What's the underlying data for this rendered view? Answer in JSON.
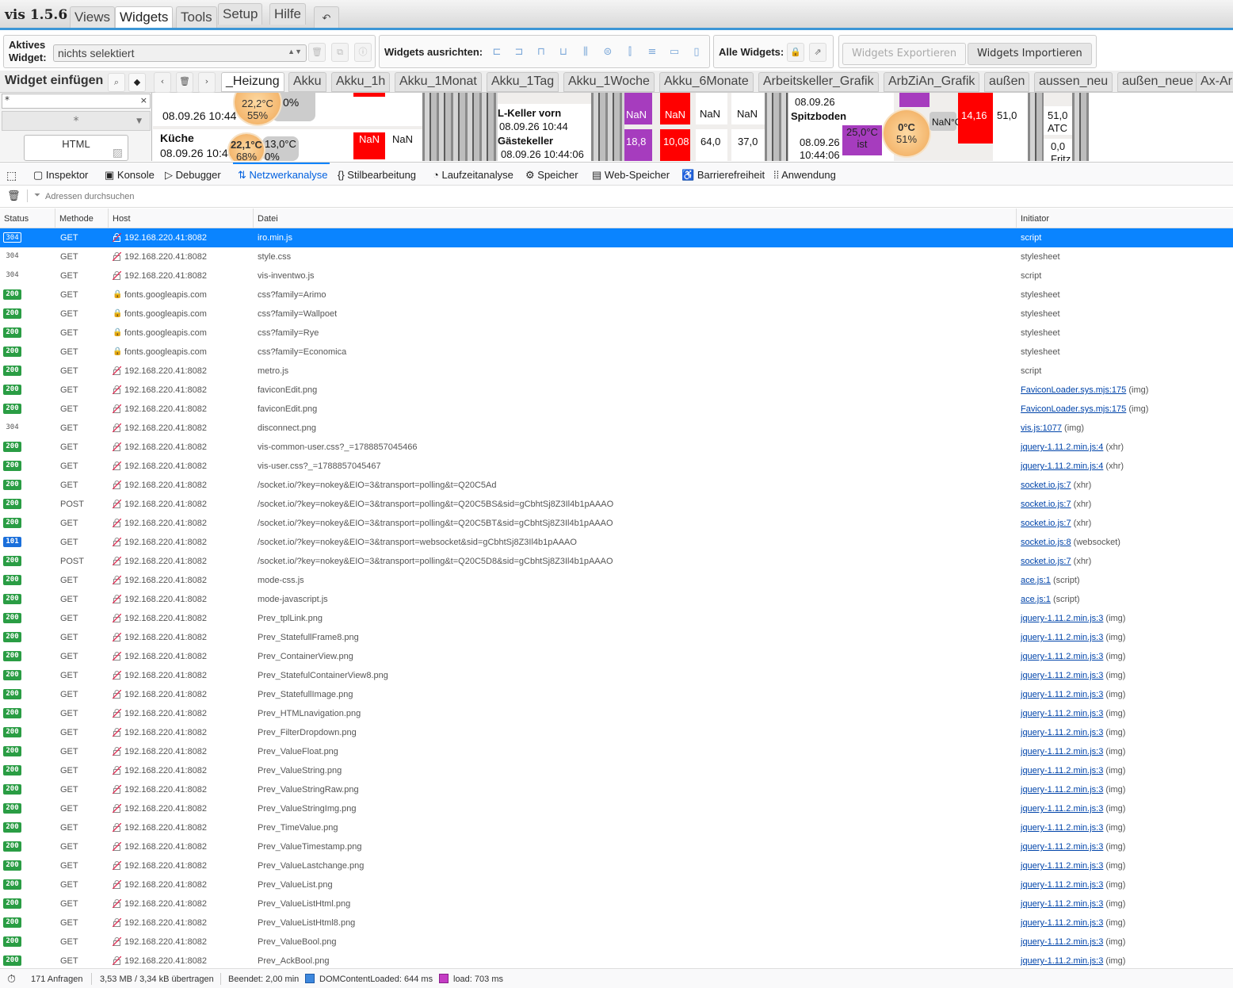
{
  "app": {
    "title": "vis 1.5.6",
    "menu_tabs": [
      "Views",
      "Widgets",
      "Tools",
      "Setup",
      "Hilfe"
    ],
    "undo_icon": "undo-icon"
  },
  "toolbar": {
    "active_widget_label": "Aktives Widget:",
    "active_widget_label_l1": "Aktives",
    "active_widget_label_l2": "Widget:",
    "active_widget_value": "nichts selektiert",
    "align_label": "Widgets ausrichten:",
    "all_widgets_label": "Alle Widgets:",
    "export_label": "Widgets Exportieren",
    "import_label": "Widgets Importieren"
  },
  "insert_bar": {
    "title": "Widget einfügen",
    "views": [
      "_Heizung",
      "Akku",
      "Akku_1h",
      "Akku_1Monat",
      "Akku_1Tag",
      "Akku_1Woche",
      "Akku_6Monate",
      "Arbeitskeller_Grafik",
      "ArbZiAn_Grafik",
      "außen",
      "aussen_neu",
      "außen_neue",
      "Ax-Ar"
    ]
  },
  "side_panel": {
    "filter_value": "*",
    "category_value": "*",
    "widget_name": "HTML"
  },
  "canvas": {
    "t1": "08.09.26 10:44",
    "temp1": "22,2°C",
    "hum1": "55%",
    "pct1": "0%",
    "kueche": "Küche",
    "t2": "08.09.26 10:44",
    "temp2": "22,1°C",
    "hum2": "68%",
    "val2": "13,0°C",
    "pct2": "0%",
    "nan1": "NaN",
    "nan2": "NaN",
    "lkeller": "L-Keller vorn",
    "t3": "08.09.26 10:44",
    "gaeste": "Gästekeller",
    "t4": "08.09.26 10:44:06",
    "nan3": "NaN",
    "nan4": "NaN",
    "nan5": "NaN",
    "nan6": "NaN",
    "v1": "18,8",
    "v2": "10,08",
    "v3": "64,0",
    "v4": "37,0",
    "t5": "08.09.26",
    "spitz": "Spitzboden",
    "t6": "08.09.26",
    "t7": "10:44:06",
    "ist": "25,0°C",
    "ist_lbl": "ist",
    "temp3": "0°C",
    "hum3": "51%",
    "nan7": "NaN°C",
    "v5": "14,16",
    "v6": "51,0",
    "v7": "51,0",
    "atc": "ATC",
    "v8": "0,0",
    "fritz": "Fritz"
  },
  "devtools": {
    "tabs": [
      "Inspektor",
      "Konsole",
      "Debugger",
      "Netzwerkanalyse",
      "Stilbearbeitung",
      "Laufzeitanalyse",
      "Speicher",
      "Web-Speicher",
      "Barrierefreiheit",
      "Anwendung"
    ],
    "filter_placeholder": "Adressen durchsuchen",
    "columns": [
      "Status",
      "Methode",
      "Host",
      "Datei",
      "Initiator"
    ]
  },
  "requests": [
    {
      "status": "304",
      "method": "GET",
      "host": "192.168.220.41:8082",
      "file": "iro.min.js",
      "initiator": "script",
      "link": "",
      "selected": true
    },
    {
      "status": "304",
      "method": "GET",
      "host": "192.168.220.41:8082",
      "file": "style.css",
      "initiator": "stylesheet",
      "link": ""
    },
    {
      "status": "304",
      "method": "GET",
      "host": "192.168.220.41:8082",
      "file": "vis-inventwo.js",
      "initiator": "script",
      "link": ""
    },
    {
      "status": "200",
      "method": "GET",
      "host": "fonts.googleapis.com",
      "file": "css?family=Arimo",
      "initiator": "stylesheet",
      "link": "",
      "lock": true
    },
    {
      "status": "200",
      "method": "GET",
      "host": "fonts.googleapis.com",
      "file": "css?family=Wallpoet",
      "initiator": "stylesheet",
      "link": "",
      "lock": true
    },
    {
      "status": "200",
      "method": "GET",
      "host": "fonts.googleapis.com",
      "file": "css?family=Rye",
      "initiator": "stylesheet",
      "link": "",
      "lock": true
    },
    {
      "status": "200",
      "method": "GET",
      "host": "fonts.googleapis.com",
      "file": "css?family=Economica",
      "initiator": "stylesheet",
      "link": "",
      "lock": true
    },
    {
      "status": "200",
      "method": "GET",
      "host": "192.168.220.41:8082",
      "file": "metro.js",
      "initiator": "script",
      "link": ""
    },
    {
      "status": "200",
      "method": "GET",
      "host": "192.168.220.41:8082",
      "file": "faviconEdit.png",
      "initiator": " (img)",
      "link": "FaviconLoader.sys.mjs:175"
    },
    {
      "status": "200",
      "method": "GET",
      "host": "192.168.220.41:8082",
      "file": "faviconEdit.png",
      "initiator": " (img)",
      "link": "FaviconLoader.sys.mjs:175"
    },
    {
      "status": "304",
      "method": "GET",
      "host": "192.168.220.41:8082",
      "file": "disconnect.png",
      "initiator": " (img)",
      "link": "vis.js:1077"
    },
    {
      "status": "200",
      "method": "GET",
      "host": "192.168.220.41:8082",
      "file": "vis-common-user.css?_=1788857045466",
      "initiator": " (xhr)",
      "link": "jquery-1.11.2.min.js:4"
    },
    {
      "status": "200",
      "method": "GET",
      "host": "192.168.220.41:8082",
      "file": "vis-user.css?_=1788857045467",
      "initiator": " (xhr)",
      "link": "jquery-1.11.2.min.js:4"
    },
    {
      "status": "200",
      "method": "GET",
      "host": "192.168.220.41:8082",
      "file": "/socket.io/?key=nokey&EIO=3&transport=polling&t=Q20C5Ad",
      "initiator": " (xhr)",
      "link": "socket.io.js:7"
    },
    {
      "status": "200",
      "method": "POST",
      "host": "192.168.220.41:8082",
      "file": "/socket.io/?key=nokey&EIO=3&transport=polling&t=Q20C5BS&sid=gCbhtSj8Z3Il4b1pAAAO",
      "initiator": " (xhr)",
      "link": "socket.io.js:7"
    },
    {
      "status": "200",
      "method": "GET",
      "host": "192.168.220.41:8082",
      "file": "/socket.io/?key=nokey&EIO=3&transport=polling&t=Q20C5BT&sid=gCbhtSj8Z3Il4b1pAAAO",
      "initiator": " (xhr)",
      "link": "socket.io.js:7"
    },
    {
      "status": "101",
      "method": "GET",
      "host": "192.168.220.41:8082",
      "file": "/socket.io/?key=nokey&EIO=3&transport=websocket&sid=gCbhtSj8Z3Il4b1pAAAO",
      "initiator": " (websocket)",
      "link": "socket.io.js:8"
    },
    {
      "status": "200",
      "method": "POST",
      "host": "192.168.220.41:8082",
      "file": "/socket.io/?key=nokey&EIO=3&transport=polling&t=Q20C5D8&sid=gCbhtSj8Z3Il4b1pAAAO",
      "initiator": " (xhr)",
      "link": "socket.io.js:7"
    },
    {
      "status": "200",
      "method": "GET",
      "host": "192.168.220.41:8082",
      "file": "mode-css.js",
      "initiator": " (script)",
      "link": "ace.js:1"
    },
    {
      "status": "200",
      "method": "GET",
      "host": "192.168.220.41:8082",
      "file": "mode-javascript.js",
      "initiator": " (script)",
      "link": "ace.js:1"
    },
    {
      "status": "200",
      "method": "GET",
      "host": "192.168.220.41:8082",
      "file": "Prev_tplLink.png",
      "initiator": " (img)",
      "link": "jquery-1.11.2.min.js:3"
    },
    {
      "status": "200",
      "method": "GET",
      "host": "192.168.220.41:8082",
      "file": "Prev_StatefullFrame8.png",
      "initiator": " (img)",
      "link": "jquery-1.11.2.min.js:3"
    },
    {
      "status": "200",
      "method": "GET",
      "host": "192.168.220.41:8082",
      "file": "Prev_ContainerView.png",
      "initiator": " (img)",
      "link": "jquery-1.11.2.min.js:3"
    },
    {
      "status": "200",
      "method": "GET",
      "host": "192.168.220.41:8082",
      "file": "Prev_StatefulContainerView8.png",
      "initiator": " (img)",
      "link": "jquery-1.11.2.min.js:3"
    },
    {
      "status": "200",
      "method": "GET",
      "host": "192.168.220.41:8082",
      "file": "Prev_StatefullImage.png",
      "initiator": " (img)",
      "link": "jquery-1.11.2.min.js:3"
    },
    {
      "status": "200",
      "method": "GET",
      "host": "192.168.220.41:8082",
      "file": "Prev_HTMLnavigation.png",
      "initiator": " (img)",
      "link": "jquery-1.11.2.min.js:3"
    },
    {
      "status": "200",
      "method": "GET",
      "host": "192.168.220.41:8082",
      "file": "Prev_FilterDropdown.png",
      "initiator": " (img)",
      "link": "jquery-1.11.2.min.js:3"
    },
    {
      "status": "200",
      "method": "GET",
      "host": "192.168.220.41:8082",
      "file": "Prev_ValueFloat.png",
      "initiator": " (img)",
      "link": "jquery-1.11.2.min.js:3"
    },
    {
      "status": "200",
      "method": "GET",
      "host": "192.168.220.41:8082",
      "file": "Prev_ValueString.png",
      "initiator": " (img)",
      "link": "jquery-1.11.2.min.js:3"
    },
    {
      "status": "200",
      "method": "GET",
      "host": "192.168.220.41:8082",
      "file": "Prev_ValueStringRaw.png",
      "initiator": " (img)",
      "link": "jquery-1.11.2.min.js:3"
    },
    {
      "status": "200",
      "method": "GET",
      "host": "192.168.220.41:8082",
      "file": "Prev_ValueStringImg.png",
      "initiator": " (img)",
      "link": "jquery-1.11.2.min.js:3"
    },
    {
      "status": "200",
      "method": "GET",
      "host": "192.168.220.41:8082",
      "file": "Prev_TimeValue.png",
      "initiator": " (img)",
      "link": "jquery-1.11.2.min.js:3"
    },
    {
      "status": "200",
      "method": "GET",
      "host": "192.168.220.41:8082",
      "file": "Prev_ValueTimestamp.png",
      "initiator": " (img)",
      "link": "jquery-1.11.2.min.js:3"
    },
    {
      "status": "200",
      "method": "GET",
      "host": "192.168.220.41:8082",
      "file": "Prev_ValueLastchange.png",
      "initiator": " (img)",
      "link": "jquery-1.11.2.min.js:3"
    },
    {
      "status": "200",
      "method": "GET",
      "host": "192.168.220.41:8082",
      "file": "Prev_ValueList.png",
      "initiator": " (img)",
      "link": "jquery-1.11.2.min.js:3"
    },
    {
      "status": "200",
      "method": "GET",
      "host": "192.168.220.41:8082",
      "file": "Prev_ValueListHtml.png",
      "initiator": " (img)",
      "link": "jquery-1.11.2.min.js:3"
    },
    {
      "status": "200",
      "method": "GET",
      "host": "192.168.220.41:8082",
      "file": "Prev_ValueListHtml8.png",
      "initiator": " (img)",
      "link": "jquery-1.11.2.min.js:3"
    },
    {
      "status": "200",
      "method": "GET",
      "host": "192.168.220.41:8082",
      "file": "Prev_ValueBool.png",
      "initiator": " (img)",
      "link": "jquery-1.11.2.min.js:3"
    },
    {
      "status": "200",
      "method": "GET",
      "host": "192.168.220.41:8082",
      "file": "Prev_AckBool.png",
      "initiator": " (img)",
      "link": "jquery-1.11.2.min.js:3"
    }
  ],
  "statusbar": {
    "requests": "171 Anfragen",
    "transferred": "3,53 MB / 3,34 kB übertragen",
    "finished": "Beendet: 2,00 min",
    "dom_loaded": "DOMContentLoaded: 644 ms",
    "load": "load: 703 ms"
  },
  "colors": {
    "accent": "#0a84ff",
    "status_ok": "#2a9d44",
    "status_switch": "#1a6fdb",
    "dom_marker": "#3c87dd",
    "load_marker": "#c43cc4"
  }
}
